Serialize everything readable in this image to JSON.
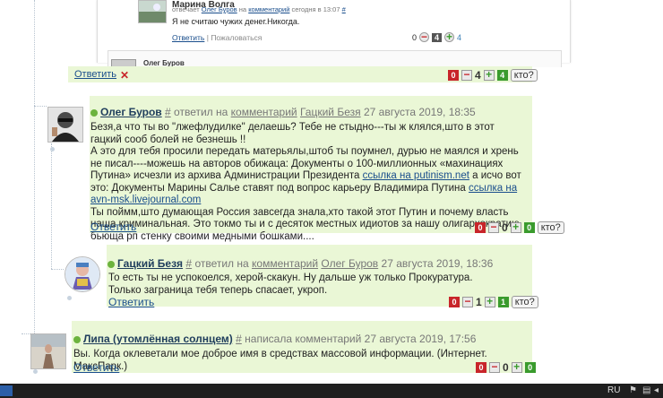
{
  "top_comment": {
    "author": "Марина Волга",
    "meta_prefix": "отвечает",
    "meta_user": "Олег Буров",
    "meta_mid": "на",
    "meta_link": "комментарий",
    "meta_time": "сегодня в 13:07",
    "hash": "#",
    "text": "Я не считаю чужих денег.Никогда.",
    "reply": "Ответить",
    "separator": "|",
    "complain": "Пожаловаться",
    "score_minus": "0",
    "score_value": "4",
    "score_plus": "4"
  },
  "strip": {
    "author": "Олег Буров",
    "reply": "Ответить",
    "red": "0",
    "score": "4",
    "green": "4",
    "who": "кто?"
  },
  "comment1": {
    "author": "Олег Буров",
    "hash": "#",
    "meta1": "ответил на",
    "meta_link": "комментарий",
    "meta_user": "Гацкий Безя",
    "date": "27 августа 2019, 18:35",
    "p1": "Безя,а что ты во \"лжефлудилке\" делаешь? Тебе не стыдно---ты ж клялся,што в этот гацкий сооб болей не безнешь !!",
    "p2a": "А это для тебя просили передать матерьялы,штоб ты поумнел, дурью не маялся и хрень не писал----можешь на авторов обижаца: Документы о 100-миллионных «махинациях Путина» исчезли из архива Администрации Президента",
    "link1": "ссылка на putinism.net",
    "p2b": "а исчо вот это: Документы Марины Салье ставят под вопрос карьеру Владимира Путина",
    "link2": "ссылка на avn-msk.livejournal.com",
    "p3": "Ты поймм,што думающая Россия завсегда знала,хто такой этот Путин и почему власть наша криминальная. Это токмо ты и с десяток местных идиотов за нашу олигархократию бьюща рп стенку своими медными бошками....",
    "reply": "Ответить",
    "red": "0",
    "score": "0",
    "green": "0",
    "who": "кто?"
  },
  "comment2": {
    "author": "Гацкий Безя",
    "hash": "#",
    "meta1": "ответил на",
    "meta_link": "комментарий",
    "meta_user": "Олег Буров",
    "date": "27 августа 2019, 18:36",
    "p1": "То есть ты не успокоелся, херой-скакун. Ну дальше уж только Прокуратура.",
    "p2": "Только заграница тебя теперь спасает, укроп.",
    "reply": "Ответить",
    "red": "0",
    "score": "1",
    "green": "1",
    "who": "кто?"
  },
  "comment3": {
    "author": "Липа (утомлённая солнцем)",
    "hash": "#",
    "meta1": "написала комментарий",
    "date": "27 августа 2019, 17:56",
    "p1": "Вы. Когда оклеветали мое доброе имя в средствах массовой информации. (Интернет. МаксПарк.)",
    "reply": "Ответить",
    "red": "0",
    "score": "0",
    "green": "0"
  },
  "taskbar": {
    "lang": "RU"
  },
  "colors": {
    "comment_bg": "#eaf7d6",
    "link": "#1a4e8c",
    "vote_red": "#c8252a",
    "vote_green": "#3a9b2d"
  }
}
